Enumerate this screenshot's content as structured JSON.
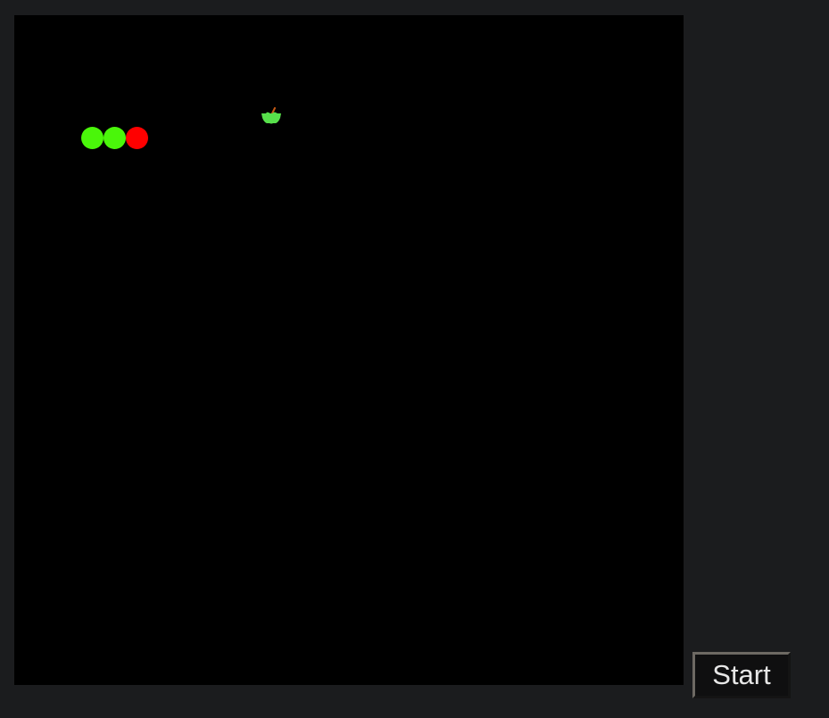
{
  "game": {
    "board_color": "#000000",
    "snake": {
      "segments": [
        {
          "role": "body",
          "color": "#4af60a"
        },
        {
          "role": "body",
          "color": "#4af60a"
        },
        {
          "role": "head",
          "color": "#ff0000"
        }
      ]
    },
    "food": {
      "type": "apple",
      "color": "#57e04b",
      "stem_color": "#c85a14"
    }
  },
  "controls": {
    "start_label": "Start"
  }
}
